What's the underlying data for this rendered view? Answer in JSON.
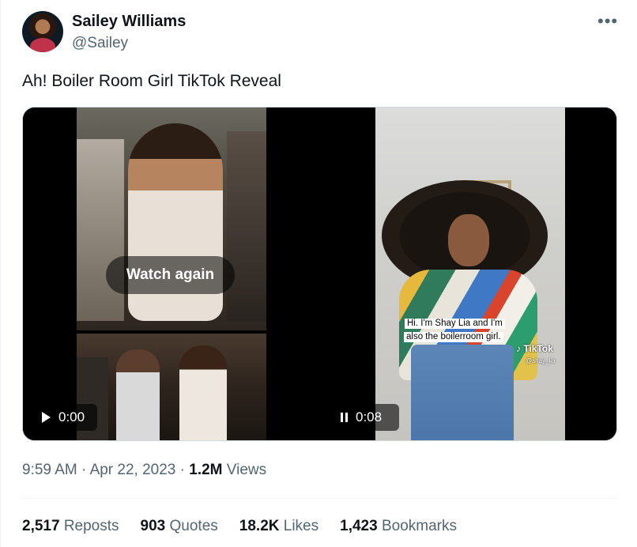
{
  "user": {
    "name": "Sailey Williams",
    "handle": "@Sailey"
  },
  "tweet": {
    "text": "Ah! Boiler Room Girl TikTok Reveal"
  },
  "media": {
    "video1": {
      "overlay": "Watch again",
      "time": "0:00"
    },
    "video2": {
      "time": "0:08",
      "caption_line1": "Hi. I'm Shay Lia and I'm",
      "caption_line2": "also the boilerroom girl.",
      "watermark": "TikTok",
      "watermark_user": "@shay_lia"
    }
  },
  "meta": {
    "time": "9:59 AM",
    "sep1": "·",
    "date": "Apr 22, 2023",
    "sep2": "·",
    "views": "1.2M",
    "views_label": "Views"
  },
  "stats": {
    "reposts": "2,517",
    "reposts_label": "Reposts",
    "quotes": "903",
    "quotes_label": "Quotes",
    "likes": "18.2K",
    "likes_label": "Likes",
    "bookmarks": "1,423",
    "bookmarks_label": "Bookmarks"
  },
  "icons": {
    "more": "more-horizontal-icon",
    "play": "play-icon",
    "pause": "pause-icon"
  },
  "colors": {
    "text": "#0f1419",
    "secondary": "#536471",
    "border": "#cfd9de"
  }
}
